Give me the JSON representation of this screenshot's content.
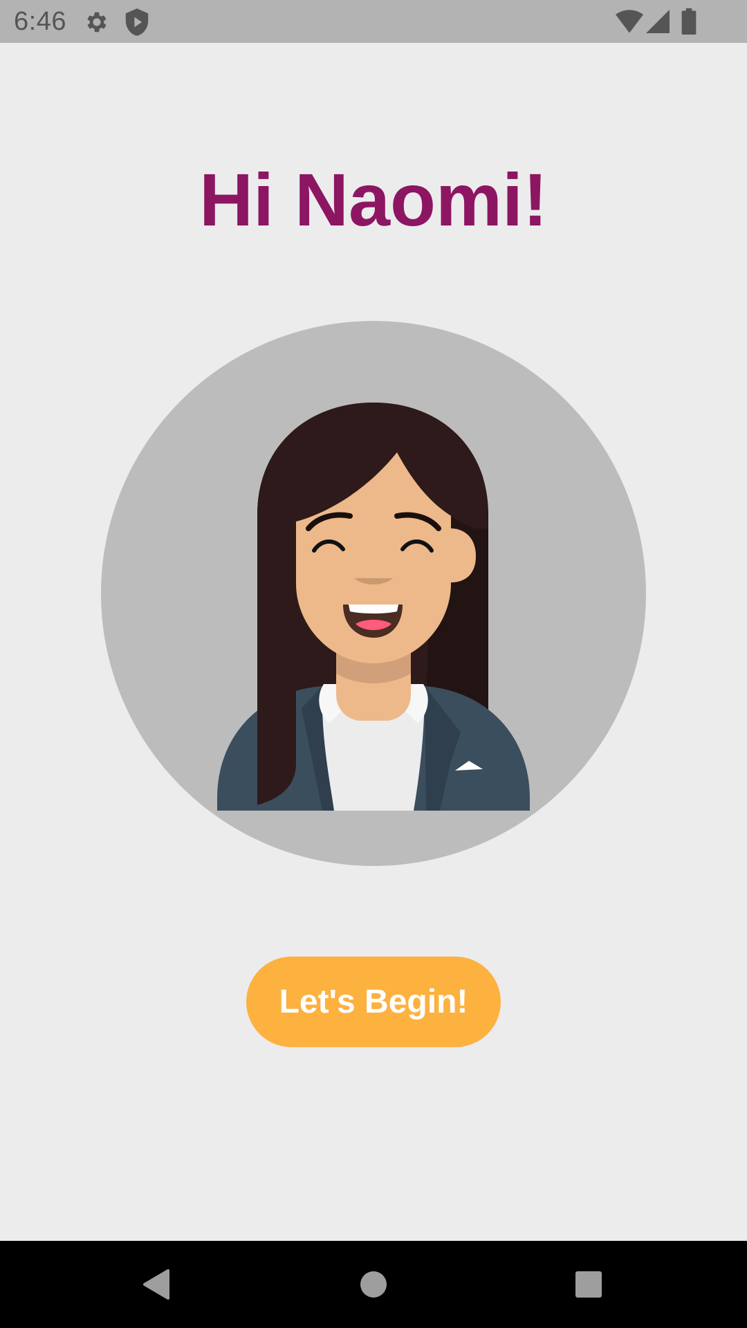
{
  "status_bar": {
    "time": "6:46",
    "icons": [
      "gear-icon",
      "play-protect-icon",
      "wifi-icon",
      "cellular-signal-icon",
      "battery-icon"
    ]
  },
  "greeting": {
    "text": "Hi Naomi!",
    "color": "#8c1662"
  },
  "avatar": {
    "description_icon": "woman-avatar-illustration",
    "circle_color": "#bcbcbc"
  },
  "primary_button": {
    "label": "Let's Begin!",
    "color": "#fdb13f"
  },
  "nav_bar": {
    "buttons": [
      "back-icon",
      "home-icon",
      "recents-icon"
    ]
  }
}
